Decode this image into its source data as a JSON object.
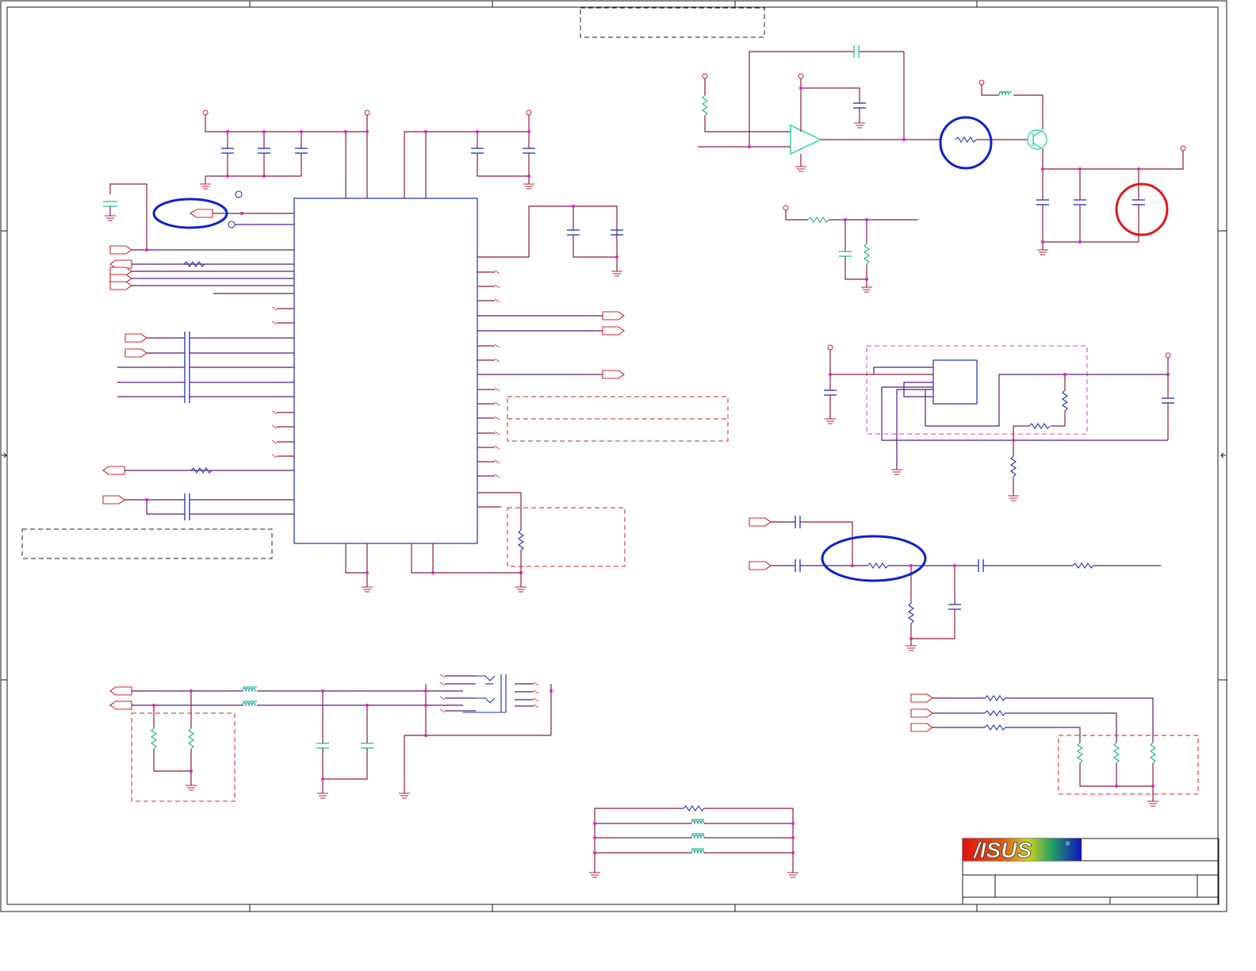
{
  "title_block": {
    "logo_text": "/ISUS",
    "logo_registered": "®",
    "colors": {
      "logo_left": "#e01010",
      "logo_mid": "#f0c020",
      "logo_right": "#1010c0"
    }
  },
  "highlights": {
    "count_blue": 3,
    "count_red": 1
  }
}
